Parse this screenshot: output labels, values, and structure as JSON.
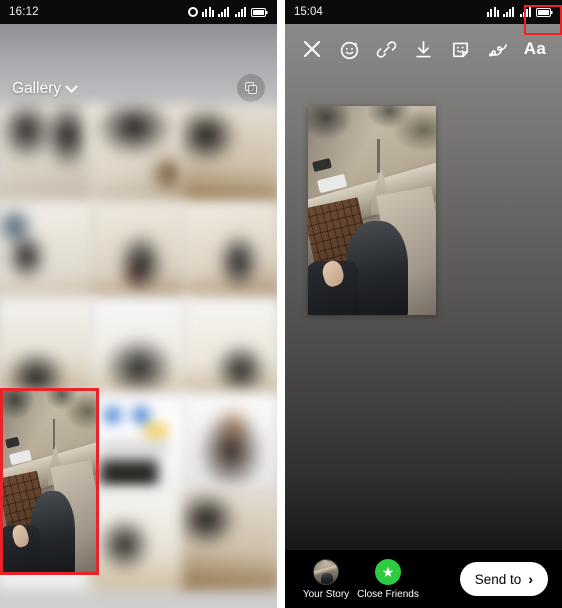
{
  "left_screen": {
    "status_bar": {
      "time": "16:12",
      "icons": [
        "alarm-icon",
        "signal-icon",
        "signal-icon",
        "signal-icon",
        "battery-icon"
      ]
    },
    "header": {
      "title": "Gallery",
      "dropdown_icon": "chevron-down-icon",
      "multiselect_icon": "multi-select-icon"
    },
    "selected_thumbnail": {
      "highlighted": true,
      "highlight_color": "#e8232a"
    }
  },
  "right_screen": {
    "status_bar": {
      "time": "15:04",
      "icons": [
        "signal-icon",
        "signal-icon",
        "signal-icon",
        "battery-icon"
      ]
    },
    "toolbar": {
      "items": [
        {
          "name": "close",
          "icon": "close-icon",
          "label": ""
        },
        {
          "name": "emoji",
          "icon": "smiley-face-icon",
          "label": ""
        },
        {
          "name": "link",
          "icon": "link-icon",
          "label": ""
        },
        {
          "name": "download",
          "icon": "download-icon",
          "label": ""
        },
        {
          "name": "sticker",
          "icon": "sticker-icon",
          "label": ""
        },
        {
          "name": "draw",
          "icon": "squiggle-draw-icon",
          "label": ""
        },
        {
          "name": "text",
          "icon": "text-icon",
          "label": "Aa"
        }
      ],
      "highlighted_item": "text",
      "highlight_color": "#e8232a"
    },
    "bottom_bar": {
      "your_story_label": "Your Story",
      "close_friends_label": "Close Friends",
      "close_friends_color": "#2ecc40",
      "send_button_label": "Send to",
      "send_button_chevron": "›"
    }
  }
}
